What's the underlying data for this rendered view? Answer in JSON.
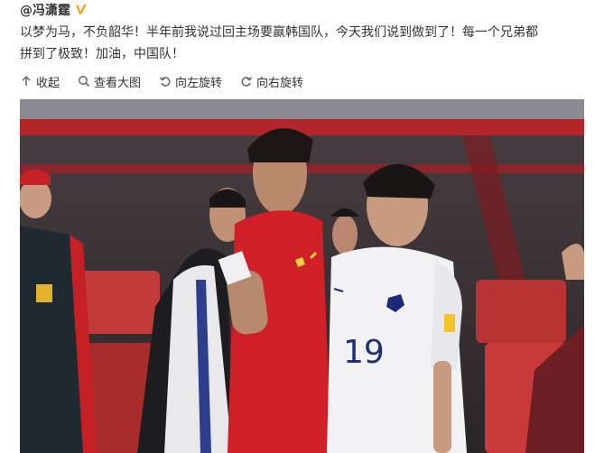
{
  "post": {
    "author": "@冯潇霆",
    "verified_icon": "verified-v-badge",
    "text_line1": "以梦为马，不负韶华！半年前我说过回主场要赢韩国队，今天我们说到做到了！每一个兄弟都",
    "text_line2": "拼到了极致！加油，中国队！"
  },
  "toolbar": {
    "collapse_label": "收起",
    "view_large_label": "查看大图",
    "rotate_left_label": "向左旋转",
    "rotate_right_label": "向右旋转"
  },
  "photo": {
    "kit_number": "19"
  },
  "colors": {
    "verified_gold": "#f5a623",
    "china_red": "#d8242a",
    "korea_white": "#f2f2f4"
  }
}
